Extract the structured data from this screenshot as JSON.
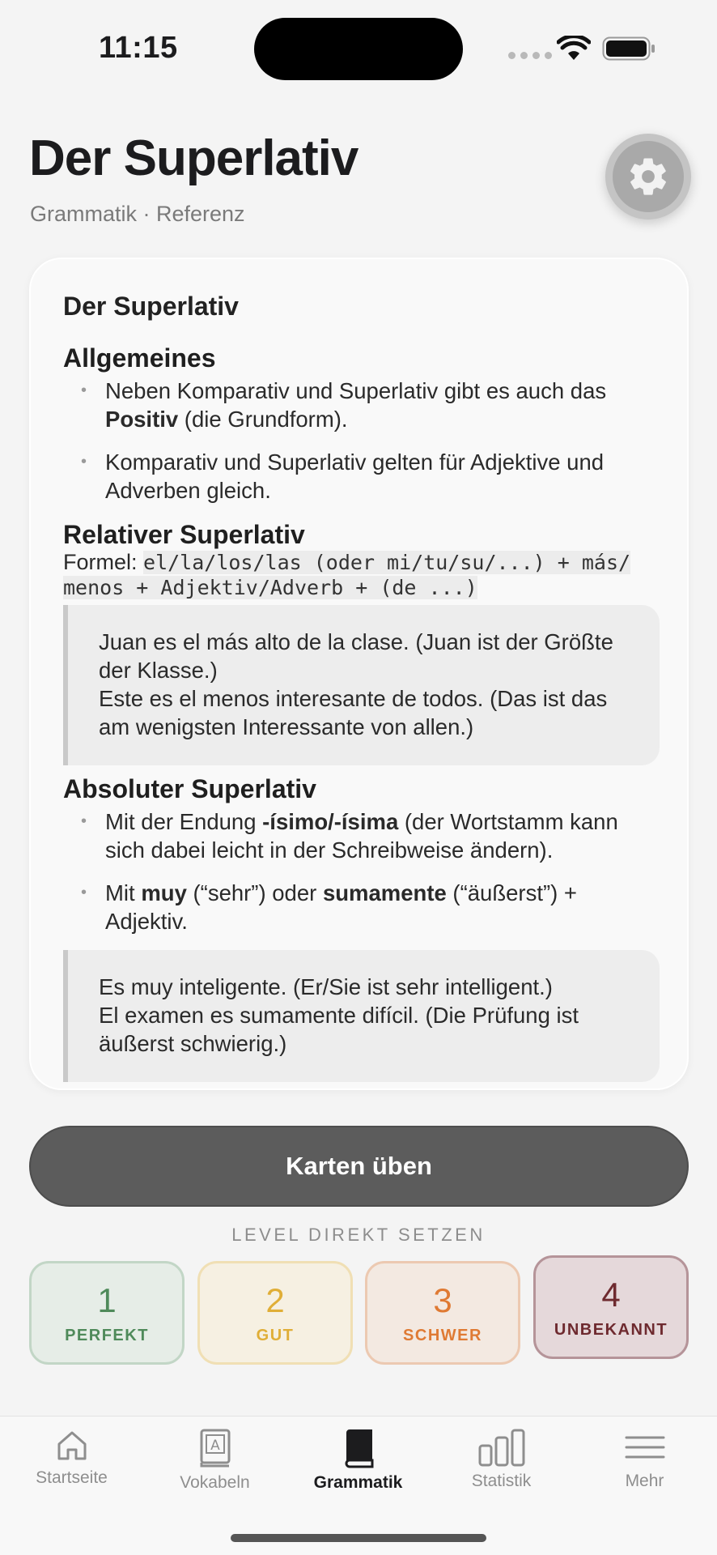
{
  "status_bar": {
    "time": "11:15"
  },
  "header": {
    "title": "Der Superlativ",
    "subtitle": "Grammatik · Referenz"
  },
  "card": {
    "title": "Der Superlativ",
    "sections": {
      "allgemeines": {
        "heading": "Allgemeines",
        "bullet1": {
          "pre": "Neben Komparativ und Superlativ gibt es auch das ",
          "bold": "Positiv",
          "post": " (die Grundform)."
        },
        "bullet2": "Komparativ und Superlativ gelten für Adjektive und Adverben gleich."
      },
      "relativ": {
        "heading": "Relativer Superlativ",
        "formula_label": "Formel: ",
        "formula_code": "el/la/los/las (oder mi/tu/su/...) + más/ menos + Adjektiv/Adverb + (de ...)",
        "example_line1": "Juan es el más alto de la clase. (Juan ist der Größte der Klasse.)",
        "example_line2": "Este es el menos interesante de todos. (Das ist das am wenigsten Interessante von allen.)"
      },
      "absolut": {
        "heading": "Absoluter Superlativ",
        "bullet1": {
          "pre": "Mit der Endung ",
          "bold": "-ísimo/-ísima",
          "post": " (der Wortstamm kann sich dabei leicht in der Schreibweise ändern)."
        },
        "bullet2": {
          "pre": "Mit ",
          "bold1": "muy",
          "mid": " (“sehr”) oder ",
          "bold2": "sumamente",
          "post": " (“äußerst”) + Adjektiv."
        },
        "example_line1": "Es muy inteligente. (Er/Sie ist sehr intelligent.)",
        "example_line2": "El examen es sumamente difícil. (Die Prüfung ist äußerst schwierig.)"
      }
    }
  },
  "practice_button": "Karten üben",
  "level_section": {
    "label": "LEVEL DIREKT SETZEN",
    "levels": [
      {
        "number": "1",
        "label": "PERFEKT"
      },
      {
        "number": "2",
        "label": "GUT"
      },
      {
        "number": "3",
        "label": "SCHWER"
      },
      {
        "number": "4",
        "label": "UNBEKANNT"
      }
    ]
  },
  "tabs": [
    {
      "label": "Startseite",
      "icon": "house-icon"
    },
    {
      "label": "Vokabeln",
      "icon": "vocab-card-icon"
    },
    {
      "label": "Grammatik",
      "icon": "book-icon",
      "active": true
    },
    {
      "label": "Statistik",
      "icon": "bar-chart-icon"
    },
    {
      "label": "Mehr",
      "icon": "menu-lines-icon"
    }
  ]
}
